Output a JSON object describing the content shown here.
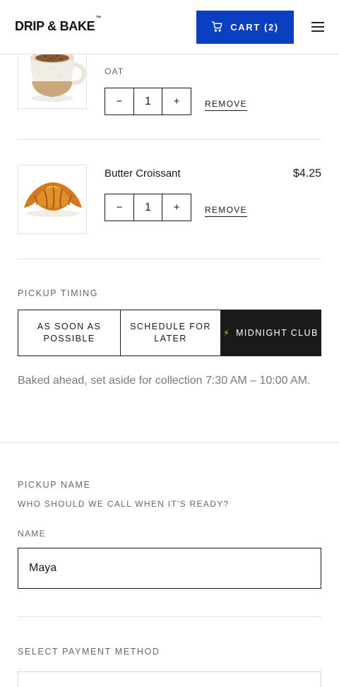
{
  "header": {
    "logo": "DRIP & BAKE",
    "logo_tm": "™",
    "cart_label": "CART (2)"
  },
  "cart": {
    "items": [
      {
        "name": "",
        "variant": "OAT",
        "quantity": "1",
        "remove_label": "REMOVE",
        "price": ""
      },
      {
        "name": "Butter Croissant",
        "variant": "",
        "quantity": "1",
        "remove_label": "REMOVE",
        "price": "$4.25"
      }
    ],
    "decrement_symbol": "−",
    "increment_symbol": "+"
  },
  "pickup_timing": {
    "label": "PICKUP TIMING",
    "options": [
      {
        "line1": "AS SOON AS",
        "line2": "POSSIBLE",
        "selected": false
      },
      {
        "line1": "SCHEDULE FOR",
        "line2": "LATER",
        "selected": false
      },
      {
        "line1": "MIDNIGHT CLUB",
        "line2": "",
        "selected": true,
        "icon": "lightning-icon"
      }
    ],
    "bolt_glyph": "⚡",
    "note": "Baked ahead, set aside for collection 7:30 AM – 10:00 AM."
  },
  "pickup_name": {
    "label": "PICKUP NAME",
    "sub_label": "WHO SHOULD WE CALL WHEN IT'S READY?",
    "field_label": "NAME",
    "value": "Maya"
  },
  "payment": {
    "label": "SELECT PAYMENT METHOD"
  },
  "colors": {
    "accent": "#0a3fc2",
    "dark": "#1a1a1a",
    "bolt": "#f2c230",
    "muted": "#666666"
  }
}
